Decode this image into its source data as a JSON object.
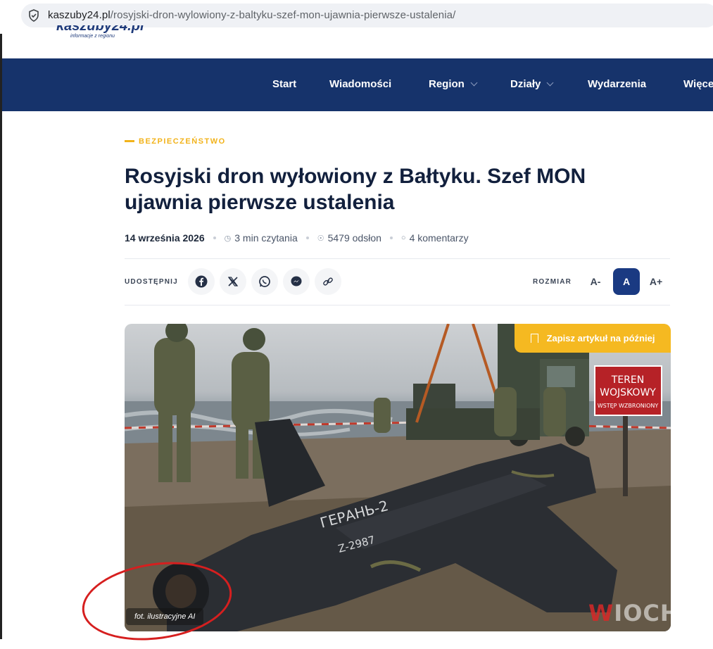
{
  "browser": {
    "url_host": "kaszuby24.pl",
    "url_path": "/rosyjski-dron-wylowiony-z-baltyku-szef-mon-ujawnia-pierwsze-ustalenia/"
  },
  "site": {
    "tagline": "informacje z regionu"
  },
  "nav": {
    "items": [
      {
        "label": "Start"
      },
      {
        "label": "Wiadomości"
      },
      {
        "label": "Region"
      },
      {
        "label": "Działy"
      },
      {
        "label": "Wydarzenia"
      },
      {
        "label": "Więce"
      }
    ]
  },
  "article": {
    "category": "BEZPIECZEŃSTWO",
    "title": "Rosyjski dron wyłowiony z Bałtyku. Szef MON ujawnia pierwsze ustalenia",
    "date": "14 września 2026",
    "read_time": "3 min czytania",
    "views": "5479 odsłon",
    "comments": "4 komentarzy"
  },
  "share": {
    "label": "UDOSTĘPNIJ",
    "icons": [
      "facebook-icon",
      "x-icon",
      "whatsapp-icon",
      "messenger-icon",
      "link-icon"
    ]
  },
  "size": {
    "label": "ROZMIAR",
    "decrease": "A-",
    "normal": "A",
    "increase": "A+"
  },
  "hero": {
    "save_label": "Zapisz artykuł na później",
    "caption": "fot. ilustracyjne AI",
    "sign_line1": "TEREN",
    "sign_line2": "WOJSKOWY",
    "sign_line3": "WSTĘP WZBRONIONY",
    "drone_text": "ГЕРАНЬ-2",
    "drone_serial": "Z-2987"
  },
  "watermark": {
    "first": "W",
    "rest": "IOCHA"
  },
  "colors": {
    "nav_bg": "#16336b",
    "accent": "#f5b921",
    "annotation": "#d61f1f"
  }
}
